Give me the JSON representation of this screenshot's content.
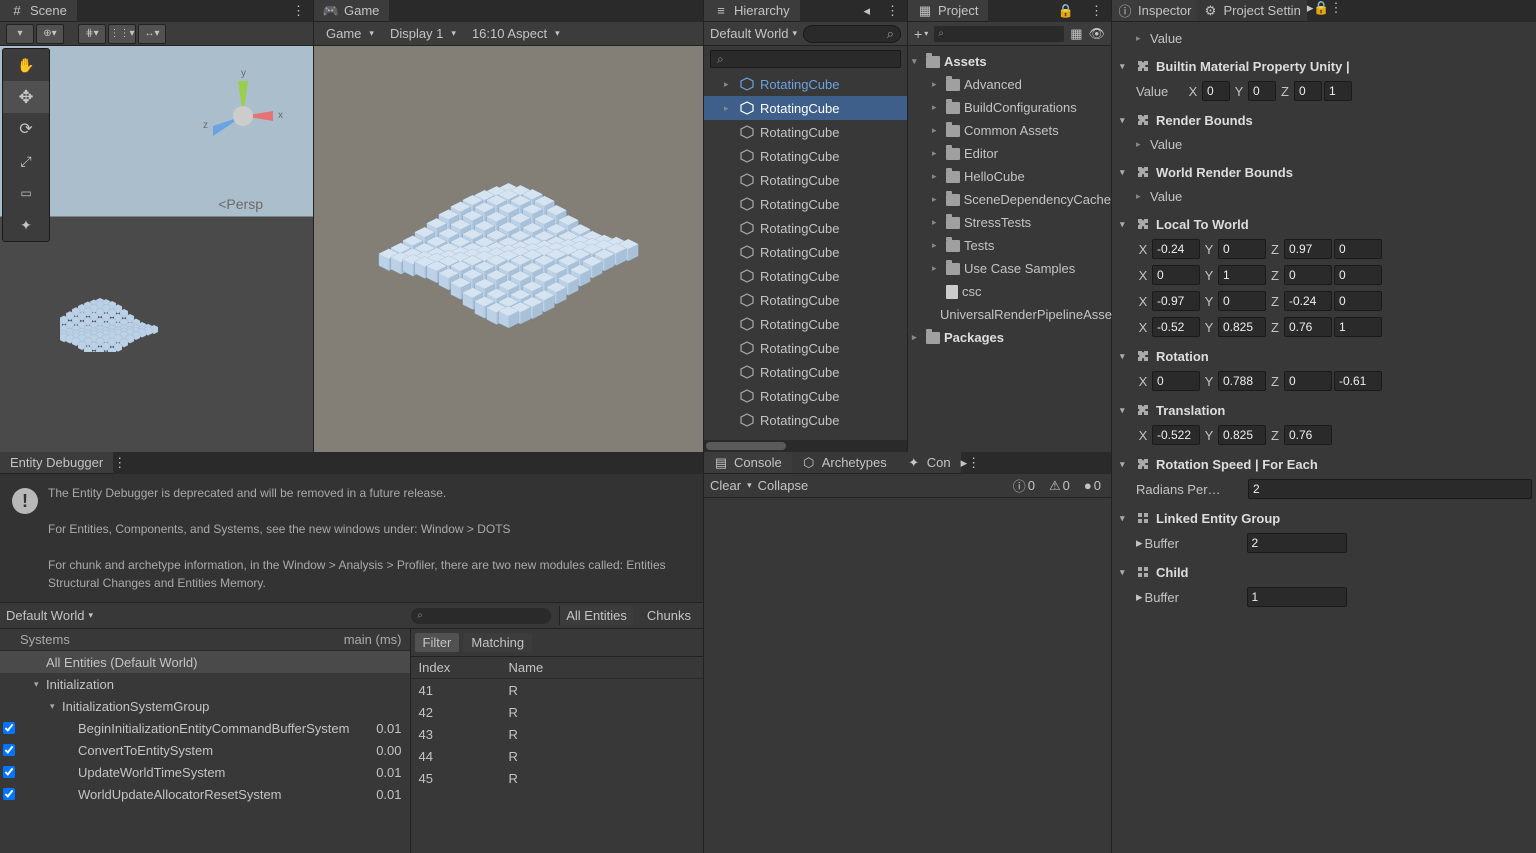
{
  "scene": {
    "tab": "Scene",
    "persp": "Persp",
    "gizmo": {
      "x": "x",
      "y": "y",
      "z": "z"
    }
  },
  "game": {
    "tab": "Game",
    "toolbar": {
      "mode": "Game",
      "display": "Display 1",
      "aspect": "16:10 Aspect"
    }
  },
  "hierarchy": {
    "tab": "Hierarchy",
    "world": "Default World",
    "items": [
      {
        "label": "RotatingCube",
        "pre": true,
        "expand": true
      },
      {
        "label": "RotatingCube",
        "sel": true,
        "expand": true
      },
      {
        "label": "RotatingCube"
      },
      {
        "label": "RotatingCube"
      },
      {
        "label": "RotatingCube"
      },
      {
        "label": "RotatingCube"
      },
      {
        "label": "RotatingCube"
      },
      {
        "label": "RotatingCube"
      },
      {
        "label": "RotatingCube"
      },
      {
        "label": "RotatingCube"
      },
      {
        "label": "RotatingCube"
      },
      {
        "label": "RotatingCube"
      },
      {
        "label": "RotatingCube"
      },
      {
        "label": "RotatingCube"
      },
      {
        "label": "RotatingCube"
      }
    ]
  },
  "project": {
    "tab": "Project",
    "tree": {
      "assets": "Assets",
      "children": [
        "Advanced",
        "BuildConfigurations",
        "Common Assets",
        "Editor",
        "HelloCube",
        "SceneDependencyCache",
        "StressTests",
        "Tests",
        "Use Case Samples"
      ],
      "csc": "csc",
      "urp": "UniversalRenderPipelineAsset",
      "packages": "Packages"
    }
  },
  "inspector": {
    "tab1": "Inspector",
    "tab2": "Project Settin",
    "value_label": "Value",
    "comp1": "Builtin Material Property Unity |",
    "vec": {
      "x": "0",
      "y": "0",
      "z": "0",
      "w": "1",
      "label": "Value",
      "xl": "X",
      "yl": "Y",
      "zl": "Z"
    },
    "comp2": "Render Bounds",
    "comp3": "World Render Bounds",
    "comp4": "Local To World",
    "matrix": [
      {
        "x": "-0.24",
        "y": "0",
        "z": "0.97",
        "w": "0"
      },
      {
        "x": "0",
        "y": "1",
        "z": "0",
        "w": "0"
      },
      {
        "x": "-0.97",
        "y": "0",
        "z": "-0.24",
        "w": "0"
      },
      {
        "x": "-0.52",
        "y": "0.825",
        "z": "0.76",
        "w": "1"
      }
    ],
    "comp5": "Rotation",
    "rotation": {
      "x": "0",
      "y": "0.788",
      "z": "0",
      "w": "-0.61"
    },
    "comp6": "Translation",
    "translation": {
      "x": "-0.522",
      "y": "0.825",
      "z": "0.76"
    },
    "comp7": "Rotation Speed | For Each",
    "radians_label": "Radians Per…",
    "radians_value": "2",
    "comp8": "Linked Entity Group",
    "buffer_label": "Buffer",
    "buffer_value": "2",
    "comp9": "Child",
    "child_buffer": "1"
  },
  "debugger": {
    "tab": "Entity Debugger",
    "msg1": "The Entity Debugger is deprecated and will be removed in a future release.",
    "msg2": "For Entities, Components, and Systems, see the new windows under: Window > DOTS",
    "msg3": "For chunk and archetype information, in the Window > Analysis > Profiler, there are two new modules called: Entities Structural Changes and Entities Memory.",
    "world": "Default World",
    "systems_hdr": "Systems",
    "main_hdr": "main (ms)",
    "rows": [
      {
        "label": "All Entities (Default World)",
        "indent": 1,
        "sel": true
      },
      {
        "label": "Initialization",
        "indent": 1,
        "arrow": true
      },
      {
        "label": "InitializationSystemGroup",
        "indent": 2,
        "arrow": true
      },
      {
        "label": "BeginInitializationEntityCommandBufferSystem",
        "indent": 3,
        "chk": true,
        "ms": "0.01"
      },
      {
        "label": "ConvertToEntitySystem",
        "indent": 3,
        "chk": true,
        "ms": "0.00"
      },
      {
        "label": "UpdateWorldTimeSystem",
        "indent": 3,
        "chk": true,
        "ms": "0.01"
      },
      {
        "label": "WorldUpdateAllocatorResetSystem",
        "indent": 3,
        "chk": true,
        "ms": "0.01"
      }
    ],
    "all_entities": "All Entities",
    "chunks": "Chunks",
    "filter": "Filter",
    "matching": "Matching",
    "index_hdr": "Index",
    "name_hdr": "Name",
    "ents": [
      {
        "idx": "41",
        "name": "R"
      },
      {
        "idx": "42",
        "name": "R"
      },
      {
        "idx": "43",
        "name": "R"
      },
      {
        "idx": "44",
        "name": "R"
      },
      {
        "idx": "45",
        "name": "R"
      }
    ]
  },
  "console": {
    "tab1": "Console",
    "tab2": "Archetypes",
    "tab3": "Con",
    "clear": "Clear",
    "collapse": "Collapse",
    "counts": {
      "info": "0",
      "warn": "0",
      "err": "0"
    }
  }
}
